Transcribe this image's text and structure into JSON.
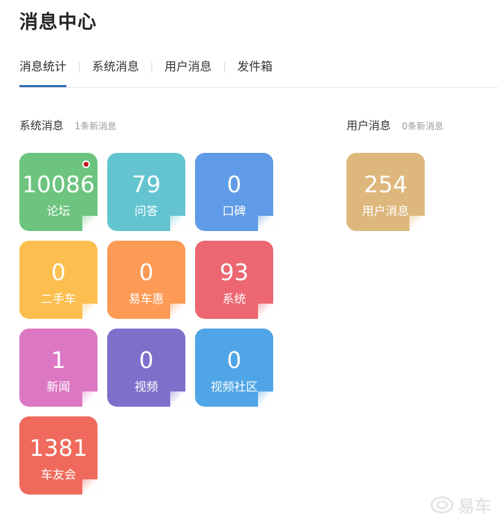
{
  "page": {
    "title": "消息中心"
  },
  "tabs": [
    {
      "label": "消息统计",
      "active": true
    },
    {
      "label": "系统消息",
      "active": false
    },
    {
      "label": "用户消息",
      "active": false
    },
    {
      "label": "发件箱",
      "active": false
    }
  ],
  "system_section": {
    "title": "系统消息",
    "new_count": "1条新消息"
  },
  "user_section": {
    "title": "用户消息",
    "new_count": "0条新消息"
  },
  "system_tiles": [
    {
      "count": "10086",
      "label": "论坛",
      "color": "#6cc47f",
      "unread": true
    },
    {
      "count": "79",
      "label": "问答",
      "color": "#63c4d0",
      "unread": false
    },
    {
      "count": "0",
      "label": "口碑",
      "color": "#5f9be6",
      "unread": false
    },
    {
      "count": "0",
      "label": "二手车",
      "color": "#fcbf4f",
      "unread": false
    },
    {
      "count": "0",
      "label": "易车惠",
      "color": "#fd9a55",
      "unread": false
    },
    {
      "count": "93",
      "label": "系统",
      "color": "#ec6771",
      "unread": false
    },
    {
      "count": "1",
      "label": "新闻",
      "color": "#dc78c3",
      "unread": false
    },
    {
      "count": "0",
      "label": "视频",
      "color": "#7f6fcb",
      "unread": false
    },
    {
      "count": "0",
      "label": "视频社区",
      "color": "#4fa5e5",
      "unread": false
    },
    {
      "count": "1381",
      "label": "车友会",
      "color": "#ef6a5c",
      "unread": false
    }
  ],
  "user_tiles": [
    {
      "count": "254",
      "label": "用户消息",
      "color": "#ddb77c",
      "unread": false
    }
  ],
  "watermark": {
    "text": "易车"
  }
}
